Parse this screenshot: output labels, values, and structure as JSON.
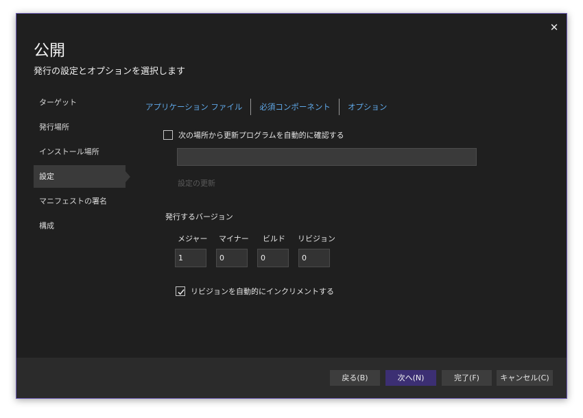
{
  "dialog": {
    "title": "公開",
    "subtitle": "発行の設定とオプションを選択します",
    "close_glyph": "✕"
  },
  "sidebar": {
    "items": [
      {
        "label": "ターゲット",
        "active": false
      },
      {
        "label": "発行場所",
        "active": false
      },
      {
        "label": "インストール場所",
        "active": false
      },
      {
        "label": "設定",
        "active": true
      },
      {
        "label": "マニフェストの署名",
        "active": false
      },
      {
        "label": "構成",
        "active": false
      }
    ]
  },
  "tabs": [
    {
      "label": "アプリケーション ファイル"
    },
    {
      "label": "必須コンポーネント"
    },
    {
      "label": "オプション"
    }
  ],
  "auto_check": {
    "label": "次の場所から更新プログラムを自動的に確認する",
    "checked": false
  },
  "update_location": {
    "value": "",
    "placeholder": ""
  },
  "update_settings_link": "設定の更新",
  "version": {
    "section_label": "発行するバージョン",
    "major_label": "メジャー",
    "minor_label": "マイナー",
    "build_label": "ビルド",
    "revision_label": "リビジョン",
    "major": "1",
    "minor": "0",
    "build": "0",
    "revision": "0"
  },
  "auto_increment": {
    "label": "リビジョンを自動的にインクリメントする",
    "checked": true
  },
  "footer": {
    "back": "戻る(B)",
    "next": "次へ(N)",
    "finish": "完了(F)",
    "cancel": "キャンセル(C)"
  },
  "icons": {
    "close": "close-icon",
    "checkmark": "checkmark-icon"
  },
  "colors": {
    "dialog_bg": "#1f1f1f",
    "accent_border": "#6f5fb8",
    "link": "#5fa8e8",
    "primary_button": "#3c2f73",
    "footer_bg": "#2b2b2b"
  }
}
